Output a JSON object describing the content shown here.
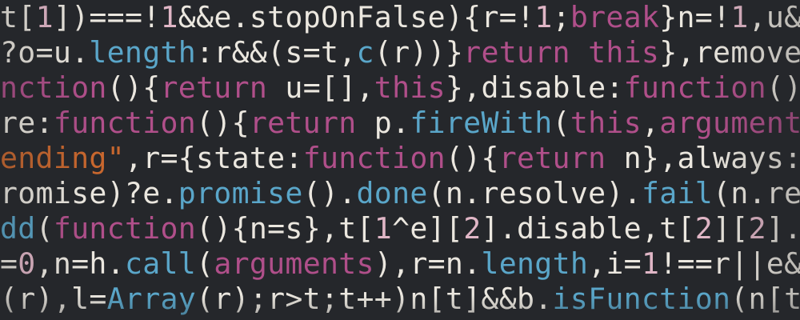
{
  "photo": {
    "lines": [
      [
        {
          "t": "t[",
          "c": "white"
        },
        {
          "t": "1",
          "c": "pink"
        },
        {
          "t": "])===!",
          "c": "white"
        },
        {
          "t": "1",
          "c": "pink"
        },
        {
          "t": "&&e.stopOnFalse){r=!",
          "c": "white"
        },
        {
          "t": "1",
          "c": "pink"
        },
        {
          "t": ";",
          "c": "white"
        },
        {
          "t": "break",
          "c": "purple"
        },
        {
          "t": "}n=!",
          "c": "white"
        },
        {
          "t": "1",
          "c": "pink"
        },
        {
          "t": ",u&&",
          "c": "white"
        }
      ],
      [
        {
          "t": "?o=u.",
          "c": "white"
        },
        {
          "t": "length",
          "c": "blue"
        },
        {
          "t": ":r&&(s=t,",
          "c": "white"
        },
        {
          "t": "c",
          "c": "blue"
        },
        {
          "t": "(r))}",
          "c": "white"
        },
        {
          "t": "return",
          "c": "purple"
        },
        {
          "t": " ",
          "c": "white"
        },
        {
          "t": "this",
          "c": "purple"
        },
        {
          "t": "},remove",
          "c": "white"
        }
      ],
      [
        {
          "t": "nction",
          "c": "purple"
        },
        {
          "t": "(){",
          "c": "white"
        },
        {
          "t": "return",
          "c": "purple"
        },
        {
          "t": " u=[],",
          "c": "white"
        },
        {
          "t": "this",
          "c": "purple"
        },
        {
          "t": "},disable:",
          "c": "white"
        },
        {
          "t": "function",
          "c": "purple"
        },
        {
          "t": "()-",
          "c": "white"
        }
      ],
      [
        {
          "t": "re:",
          "c": "white"
        },
        {
          "t": "function",
          "c": "purple"
        },
        {
          "t": "(){",
          "c": "white"
        },
        {
          "t": "return",
          "c": "purple"
        },
        {
          "t": " p.",
          "c": "white"
        },
        {
          "t": "fireWith",
          "c": "blue"
        },
        {
          "t": "(",
          "c": "white"
        },
        {
          "t": "this",
          "c": "purple"
        },
        {
          "t": ",",
          "c": "white"
        },
        {
          "t": "arguments",
          "c": "purple"
        }
      ],
      [
        {
          "t": "ending\"",
          "c": "orange"
        },
        {
          "t": ",r={state:",
          "c": "white"
        },
        {
          "t": "function",
          "c": "purple"
        },
        {
          "t": "(){",
          "c": "white"
        },
        {
          "t": "return",
          "c": "purple"
        },
        {
          "t": " n},always:f",
          "c": "white"
        }
      ],
      [
        {
          "t": "romise)?e.",
          "c": "white"
        },
        {
          "t": "promise",
          "c": "blue"
        },
        {
          "t": "().",
          "c": "white"
        },
        {
          "t": "done",
          "c": "blue"
        },
        {
          "t": "(n.resolve).",
          "c": "white"
        },
        {
          "t": "fail",
          "c": "blue"
        },
        {
          "t": "(n.rej",
          "c": "white"
        }
      ],
      [
        {
          "t": "dd",
          "c": "blue"
        },
        {
          "t": "(",
          "c": "white"
        },
        {
          "t": "function",
          "c": "purple"
        },
        {
          "t": "(){n=s},t[",
          "c": "white"
        },
        {
          "t": "1",
          "c": "pink"
        },
        {
          "t": "^e][",
          "c": "white"
        },
        {
          "t": "2",
          "c": "pink"
        },
        {
          "t": "].disable,t[",
          "c": "white"
        },
        {
          "t": "2",
          "c": "pink"
        },
        {
          "t": "][",
          "c": "white"
        },
        {
          "t": "2",
          "c": "pink"
        },
        {
          "t": "].",
          "c": "white"
        }
      ],
      [
        {
          "t": "=",
          "c": "white"
        },
        {
          "t": "0",
          "c": "pink"
        },
        {
          "t": ",n=h.",
          "c": "white"
        },
        {
          "t": "call",
          "c": "blue"
        },
        {
          "t": "(",
          "c": "white"
        },
        {
          "t": "arguments",
          "c": "purple"
        },
        {
          "t": "),r=n.",
          "c": "white"
        },
        {
          "t": "length",
          "c": "blue"
        },
        {
          "t": ",i=",
          "c": "white"
        },
        {
          "t": "1",
          "c": "pink"
        },
        {
          "t": "!==r||e&&",
          "c": "white"
        }
      ],
      [
        {
          "t": "(r),l=",
          "c": "white"
        },
        {
          "t": "Array",
          "c": "blue"
        },
        {
          "t": "(r);r>t;t++)n[t]&&b.",
          "c": "white"
        },
        {
          "t": "isFunction",
          "c": "blue"
        },
        {
          "t": "(n[t",
          "c": "white"
        }
      ]
    ],
    "colors": {
      "background": "#25272b",
      "plain": "#ebe7df",
      "keyword": "#b04f8a",
      "method": "#5aa6c9",
      "number": "#e0b6c6",
      "string": "#c8672e"
    }
  }
}
